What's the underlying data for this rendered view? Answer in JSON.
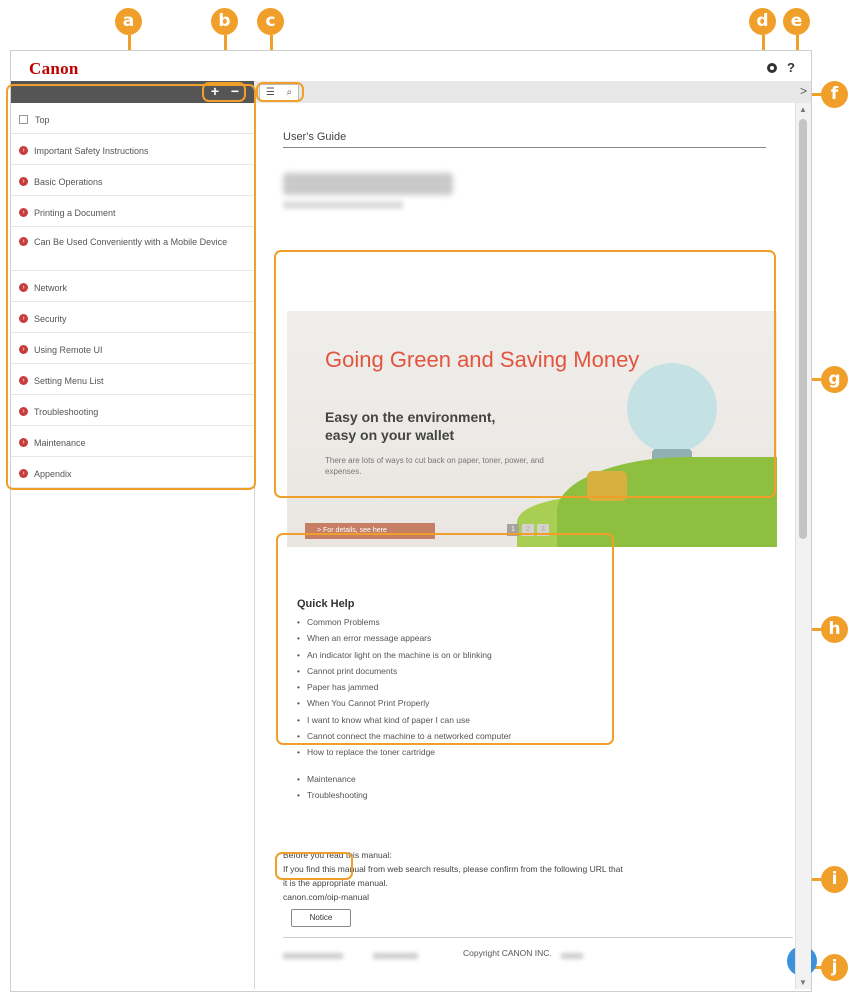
{
  "header": {
    "logo": "Canon",
    "settings_icon": "gear-icon",
    "help_label": "?"
  },
  "toolbar": {
    "expand_label": "+",
    "collapse_label": "−",
    "toc_icon": "list-icon",
    "search_icon": "search-icon",
    "collapse_panel_label": ">"
  },
  "toc": {
    "items": [
      {
        "label": "Top",
        "marker": "square"
      },
      {
        "label": "Important Safety Instructions",
        "marker": "circle"
      },
      {
        "label": "Basic Operations",
        "marker": "circle"
      },
      {
        "label": "Printing a Document",
        "marker": "circle"
      },
      {
        "label": "Can Be Used Conveniently with a Mobile Device",
        "marker": "circle"
      },
      {
        "label": "Network",
        "marker": "circle"
      },
      {
        "label": "Security",
        "marker": "circle"
      },
      {
        "label": "Using Remote UI",
        "marker": "circle"
      },
      {
        "label": "Setting Menu List",
        "marker": "circle"
      },
      {
        "label": "Troubleshooting",
        "marker": "circle"
      },
      {
        "label": "Maintenance",
        "marker": "circle"
      },
      {
        "label": "Appendix",
        "marker": "circle"
      }
    ]
  },
  "main": {
    "guide_title": "User's Guide",
    "banner": {
      "title": "Going Green and Saving Money",
      "subtitle_line1": "Easy on the environment,",
      "subtitle_line2": "easy on your wallet",
      "description": "There are lots of ways to cut back on paper, toner, power, and expenses.",
      "button": "> For details, see here",
      "pages": [
        "1",
        "2",
        "3"
      ]
    },
    "quick_help": {
      "title": "Quick Help",
      "items": [
        "Common Problems",
        "When an error message appears",
        "An indicator light on the machine is on or blinking",
        "Cannot print documents",
        "Paper has jammed",
        "When You Cannot Print Properly",
        "I want to know what kind of paper I can use",
        "Cannot connect the machine to a networked computer",
        "How to replace the toner cartridge"
      ],
      "items_extra": [
        "Maintenance",
        "Troubleshooting"
      ]
    },
    "before_reading": {
      "line1": "Before you read this manual:",
      "line2": "If you find this manual from web search results, please confirm from the following URL that",
      "line3": "it is the appropriate manual.",
      "url": "canon.com/oip-manual"
    },
    "notice_button": "Notice",
    "copyright": "Copyright CANON INC.",
    "back_to_top": "⌃"
  },
  "callouts": [
    "a",
    "b",
    "c",
    "d",
    "e",
    "f",
    "g",
    "h",
    "i",
    "j"
  ],
  "colors": {
    "accent": "#f0a02a",
    "brand": "#c00000",
    "toc_bullet": "#c83c3c",
    "top_button": "#3a92dd",
    "banner_title": "#e2543e"
  }
}
